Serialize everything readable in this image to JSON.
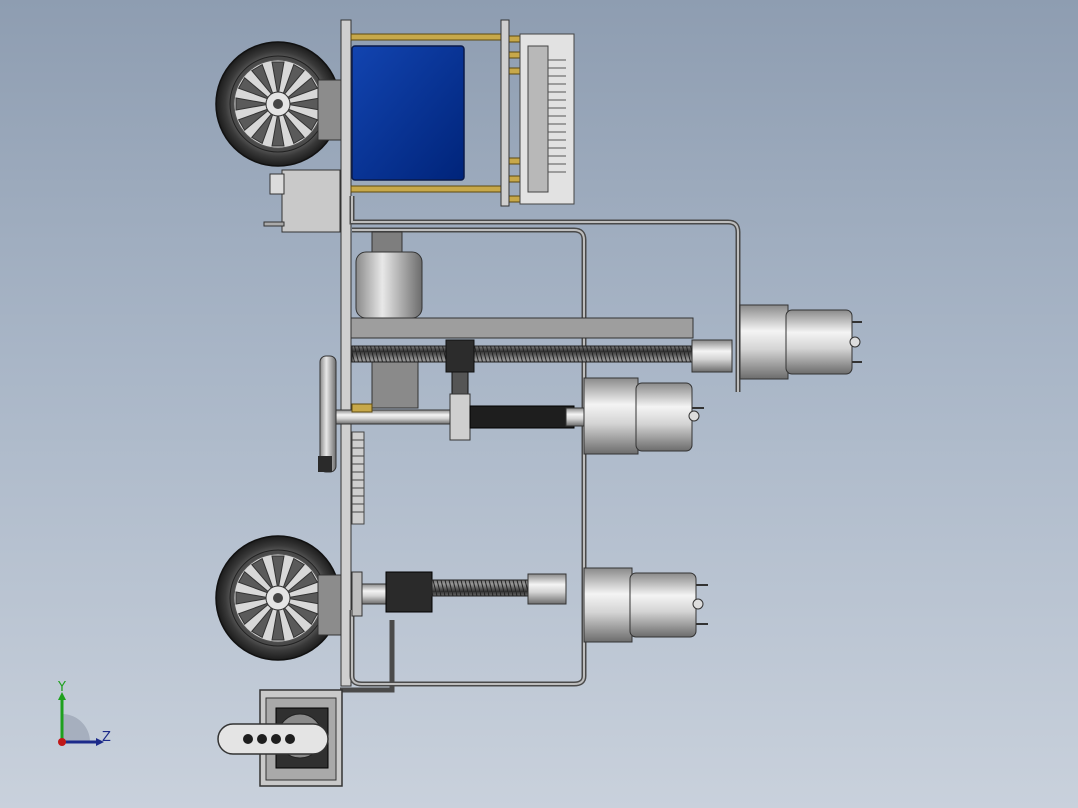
{
  "viewport": {
    "background_top": "#8e9db1",
    "background_bottom": "#c9d1dc"
  },
  "model": {
    "description_icon": "cad-assembly-robot-chassis",
    "colors": {
      "metal_light": "#e6e6e6",
      "metal_mid": "#a7a7a7",
      "metal_dark": "#5a5a5a",
      "battery_blue": "#003090",
      "brass": "#b99a3a",
      "tire": "#3c3c3c",
      "black": "#1e1e1e"
    }
  },
  "triad": {
    "y_label": "Y",
    "z_label": "Z",
    "y_color": "#1ea01e",
    "z_color": "#1c2a8a",
    "x_color": "#c01818"
  }
}
